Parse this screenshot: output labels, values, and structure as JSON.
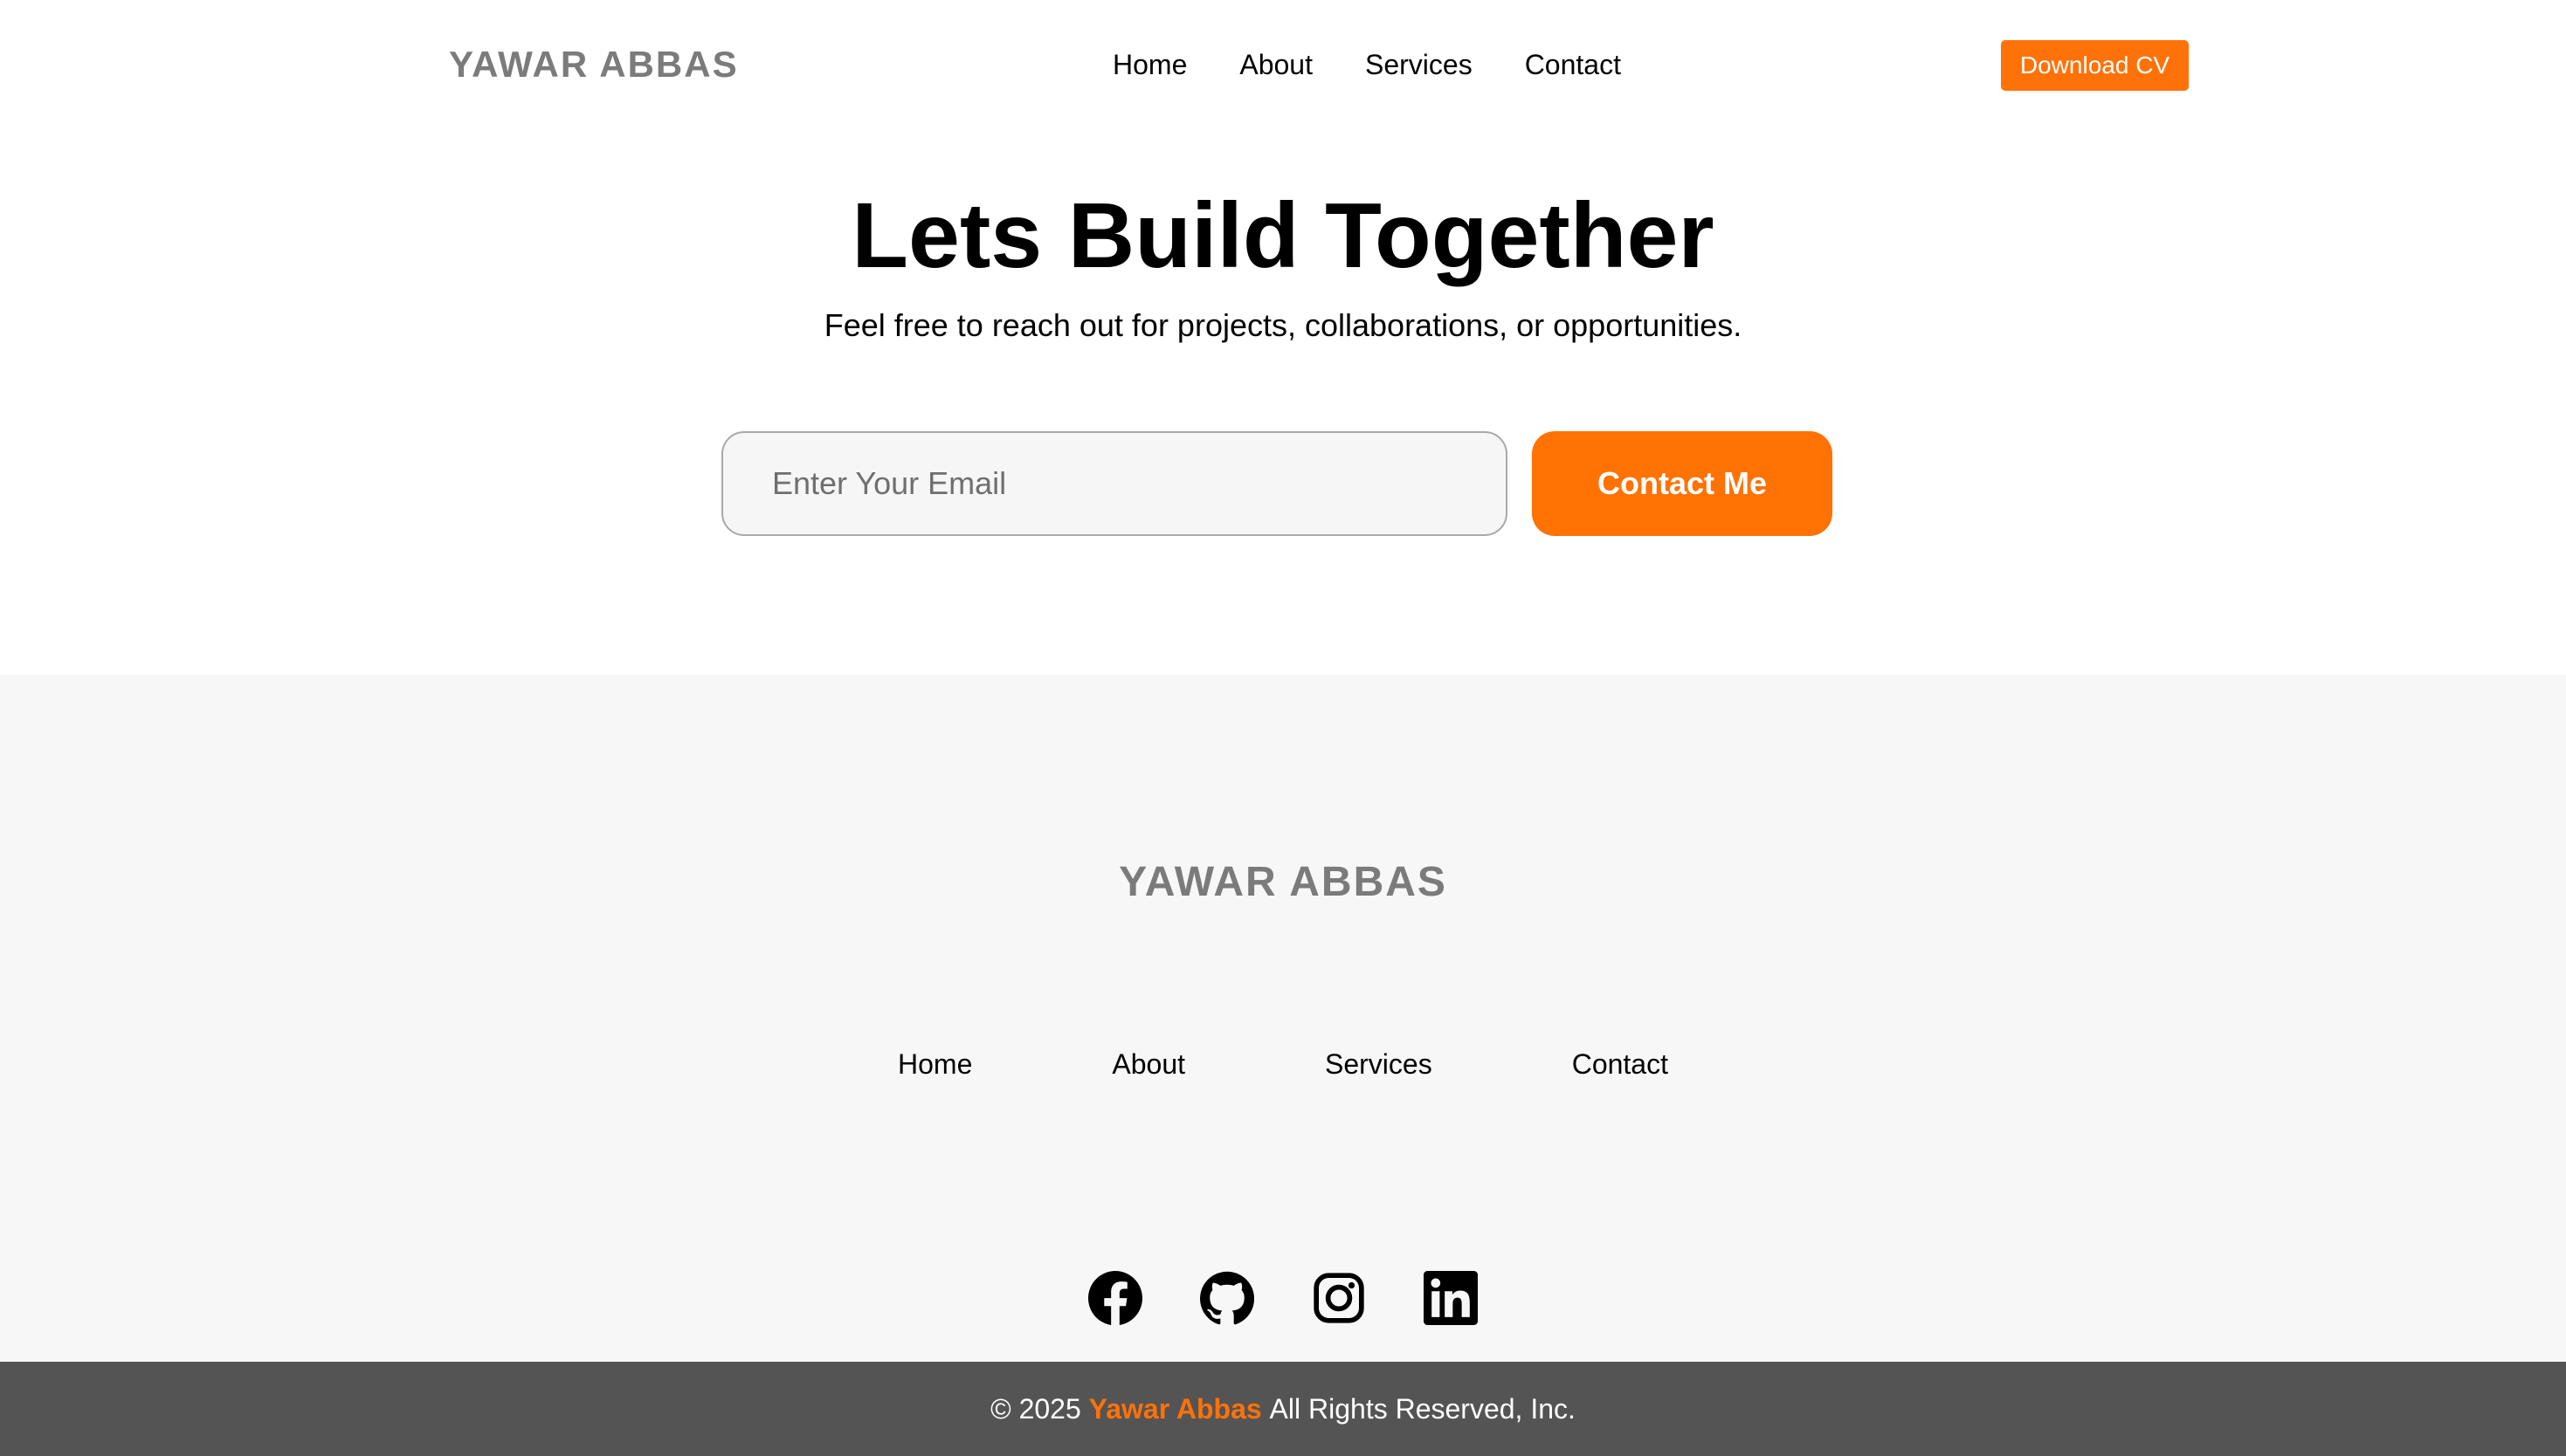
{
  "header": {
    "logo": "YAWAR ABBAS",
    "nav": [
      "Home",
      "About",
      "Services",
      "Contact"
    ],
    "cv_button": "Download CV"
  },
  "hero": {
    "title": "Lets Build Together",
    "subtitle": "Feel free to reach out for projects, collaborations, or opportunities.",
    "email_placeholder": "Enter Your Email",
    "email_value": "",
    "contact_button": "Contact Me"
  },
  "footer": {
    "logo": "YAWAR ABBAS",
    "nav": [
      "Home",
      "About",
      "Services",
      "Contact"
    ],
    "socials": [
      "facebook-icon",
      "github-icon",
      "instagram-icon",
      "linkedin-icon"
    ],
    "copyright_prefix": "© 2025",
    "copyright_brand": "Yawar Abbas",
    "copyright_suffix": "All Rights Reserved, Inc."
  },
  "colors": {
    "accent": "#ff7209",
    "logo_gray": "#7b7b7b",
    "footer_bg": "#f7f7f7",
    "bottom_bar": "#545454"
  }
}
